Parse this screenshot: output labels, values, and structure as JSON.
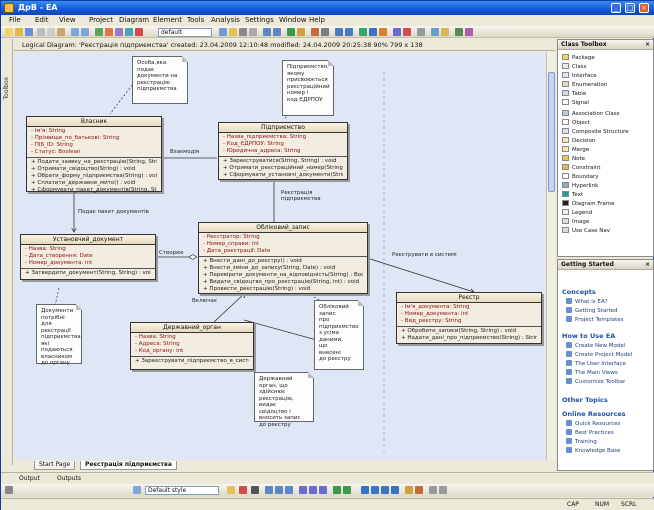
{
  "window": {
    "title": "ДрВ - EA"
  },
  "menu": [
    "File",
    "Edit",
    "View",
    "Project",
    "Diagram",
    "Element",
    "Tools",
    "Analysis",
    "Settings",
    "Window",
    "Help"
  ],
  "toolbar": {
    "search_value": "default"
  },
  "diagram_header": "Logical Diagram: 'Реєстрація підприємства'  created: 23.04.2009 12:10:48  modified: 24.04.2009 20:25:38  90%  799 x 138",
  "left_strip_label": "Toolbox",
  "classes": {
    "owner": {
      "name": "Власник",
      "attrs": [
        "- Ім'я: String",
        "- Прізвище_по_батькові: String",
        "- ПІБ_ID: String",
        "- Статус: Boolean"
      ],
      "ops": [
        "+ Подати_заявку_на_реєстрацію(String, String) : void",
        "+ Отримати_свідоцтво(String) : void",
        "+ Обрати_форму_підприємства(String) : void",
        "+ Сплатити_державне_мито() : void",
        "+ Сформувати_пакет_документів(String, String) : Boolean"
      ]
    },
    "business": {
      "name": "Підприємство",
      "attrs": [
        "- Назва_підприємства: String",
        "- Код_ЄДРПОУ: String",
        "- Юридична_адреса: String"
      ],
      "ops": [
        "+ Зареєструватися(String, String) : void",
        "+ Отримати_реєстраційний_номер(String) : void",
        "+ Сформувати_установчі_документи(String) : void"
      ]
    },
    "founder_doc": {
      "name": "Установчий_документ",
      "attrs": [
        "- Назва: String",
        "- Дата_створення: Date",
        "- Номер_документа: int"
      ],
      "ops": [
        "+ Затвердити_документ(String, String) : void"
      ]
    },
    "main": {
      "name": "Обліковий_запис",
      "attrs": [
        "- Реєстратор: String",
        "- Номер_справи: int",
        "- Дата_реєстрації: Date"
      ],
      "ops": [
        "+ Внести_дані_до_реєстру() : void",
        "+ Внести_зміни_до_запису(String, Date) : void",
        "+ Перевірити_документи_на_відповідність(String) : Boolean",
        "+ Видати_свідоцтво_про_реєстрацію(String, int) : void",
        "+ Провести_реєстрацію(String) : void"
      ]
    },
    "registry": {
      "name": "Реєстр",
      "attrs": [
        "- Ім'я_документа: String",
        "- Номер_документа: int",
        "- Вид_реєстру: String"
      ],
      "ops": [
        "+ Обробити_записи(String, String) : void",
        "+ Надати_дані_про_підприємство(String) : String"
      ]
    },
    "state": {
      "name": "Державний_орган",
      "attrs": [
        "- Назва: String",
        "- Адреса: String",
        "- Код_органу: int",
        "- Вид: String"
      ],
      "ops": [
        "+ Зареєструвати_підприємство_в_системі() : void"
      ]
    }
  },
  "notes": {
    "n1": "Особа,яка подає\nдокументи на\nреєстрацію\nпідприємства",
    "n2": "Підприємство,\nякому\nприсвоюється\nреєстраційний\nномер і\nкод ЄДРПОУ",
    "n3": "Документи\nпотрібні для\nреєстрації\nпідприємства,\nякі подаються\nвласником\nдо органу",
    "n4": "Обліковий\nзапис\nпро\nпідприємство\nз усіма\nданими,\nщо\nвнесені\nдо реєстру",
    "n5": "Державний\nорган, що\nздійснює\nреєстрацію,\nвидає\nсвідоцтво і\nвносить запис\nдо реєстру"
  },
  "labels": {
    "l1": "Взаємодія",
    "l2": "Подає пакет документів",
    "l3": "Створює",
    "l4": "Включає",
    "l5": "Реєструвати в системі",
    "l6": "Реєстрація підприємства"
  },
  "diagram_tabs": [
    "Start Page",
    "Реєстрація підприємства"
  ],
  "output_tabs": [
    "Output",
    "Outputs"
  ],
  "bottom_toolbar": {
    "style_select": "Default style"
  },
  "status": {
    "caps": "CAP",
    "num": "NUM",
    "scrl": "SCRL"
  },
  "toolbox_panel": {
    "title": "Class Toolbox",
    "items": [
      "Package",
      "Class",
      "Interface",
      "Enumeration",
      "Table",
      "Signal",
      "Association Class",
      "Object",
      "Composite Structure",
      "Decision",
      "Merge",
      "Note",
      "Constraint",
      "Boundary",
      "Hyperlink",
      "Text",
      "Diagram Frame",
      "Legend",
      "Image",
      "Use Case Nav"
    ]
  },
  "getting_started": {
    "title": "Getting Started",
    "concepts_label": "Concepts",
    "concepts": [
      "What is EA?",
      "Getting Started",
      "Project Templates"
    ],
    "howto_label": "How to Use EA",
    "howto": [
      "Create New Model",
      "Create Project Model",
      "The User Interface",
      "The Main Views",
      "Customize Toolbar"
    ],
    "other_label": "Other Topics",
    "online_label": "Online Resources",
    "online": [
      "Quick Resources",
      "Best Practices",
      "Training",
      "Knowledge Base"
    ]
  }
}
